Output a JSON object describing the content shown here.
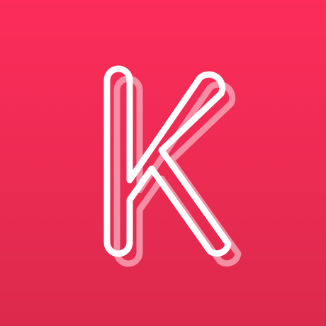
{
  "icon": {
    "logo_text": "K",
    "icon_name": "letter-k-logo-icon",
    "colors": {
      "gradient_top": "#fd2c5a",
      "gradient_bottom": "#dc2a4c",
      "outline": "#ffffff",
      "shadow_outline": "#f7a0b2"
    }
  }
}
